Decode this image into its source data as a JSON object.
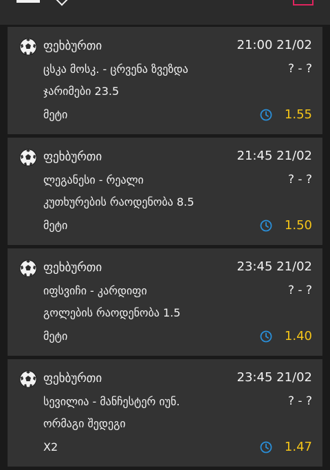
{
  "colors": {
    "background": "#1a1a1a",
    "card": "#333333",
    "odds": "#f5c518",
    "clock": "#2a8fd9",
    "slip_accent": "#e0245e"
  },
  "icons": {
    "sport": "soccer-ball-icon",
    "time": "clock-icon",
    "top_left": "menu-icon",
    "top_chevron": "chevron-down-icon",
    "top_right": "bet-slip-icon"
  },
  "bets": [
    {
      "sport": "ფეხბურთი",
      "time": "21:00 21/02",
      "match": "ცსკა მოსკ. - ცრვენა ზვეზდა",
      "score": "? - ?",
      "market": "ჯარიმები 23.5",
      "selection": "მეტი",
      "odds": "1.55"
    },
    {
      "sport": "ფეხბურთი",
      "time": "21:45 21/02",
      "match": "ლეგანესი - რეალი",
      "score": "? - ?",
      "market": "კუთხურების რაოდენობა 8.5",
      "selection": "მეტი",
      "odds": "1.50"
    },
    {
      "sport": "ფეხბურთი",
      "time": "23:45 21/02",
      "match": "იფსვიჩი - კარდიფი",
      "score": "? - ?",
      "market": "გოლების რაოდენობა 1.5",
      "selection": "მეტი",
      "odds": "1.40"
    },
    {
      "sport": "ფეხბურთი",
      "time": "23:45 21/02",
      "match": "სევილია - მანჩესტერ იუნ.",
      "score": "? - ?",
      "market": "ორმაგი შედეგი",
      "selection": "X2",
      "odds": "1.47"
    }
  ]
}
